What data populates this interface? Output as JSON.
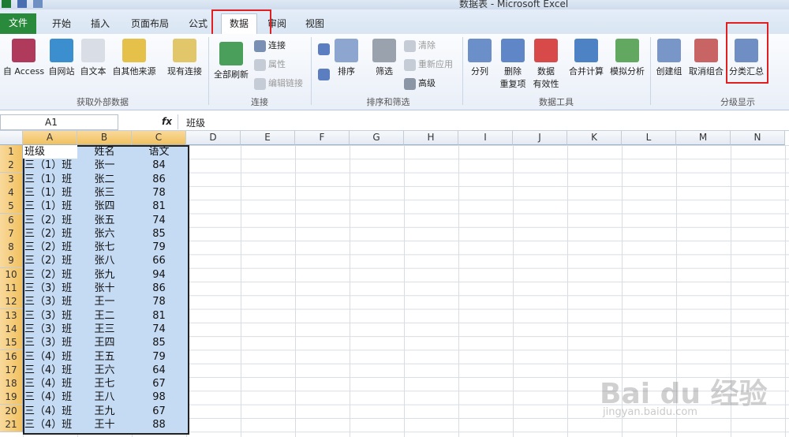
{
  "window": {
    "title": "数据表 - Microsoft Excel"
  },
  "tabs": [
    "文件",
    "开始",
    "插入",
    "页面布局",
    "公式",
    "数据",
    "审阅",
    "视图"
  ],
  "ribbon": {
    "external": {
      "access": "自 Access",
      "web": "自网站",
      "text": "自文本",
      "other": "自其他来源",
      "existing": "现有连接",
      "group": "获取外部数据"
    },
    "connections": {
      "refresh": "全部刷新",
      "conn": "连接",
      "props": "属性",
      "edit": "编辑链接",
      "group": "连接"
    },
    "sortfilter": {
      "sort": "排序",
      "filter": "筛选",
      "clear": "清除",
      "reapply": "重新应用",
      "advanced": "高级",
      "group": "排序和筛选"
    },
    "tools": {
      "split": "分列",
      "dedup1": "删除",
      "dedup2": "重复项",
      "valid1": "数据",
      "valid2": "有效性",
      "consolidate": "合并计算",
      "whatif": "模拟分析",
      "group": "数据工具"
    },
    "outline": {
      "groupbtn": "创建组",
      "ungroup": "取消组合",
      "subtotal": "分类汇总",
      "group": "分级显示"
    }
  },
  "formula": {
    "cell": "A1",
    "fx": "fx",
    "value": "班级"
  },
  "columns": [
    "A",
    "B",
    "C",
    "D",
    "E",
    "F",
    "G",
    "H",
    "I",
    "J",
    "K",
    "L",
    "M",
    "N"
  ],
  "rows": [
    [
      "班级",
      "姓名",
      "语文"
    ],
    [
      "三（1）班",
      "张一",
      "84"
    ],
    [
      "三（1）班",
      "张二",
      "86"
    ],
    [
      "三（1）班",
      "张三",
      "78"
    ],
    [
      "三（1）班",
      "张四",
      "81"
    ],
    [
      "三（2）班",
      "张五",
      "74"
    ],
    [
      "三（2）班",
      "张六",
      "85"
    ],
    [
      "三（2）班",
      "张七",
      "79"
    ],
    [
      "三（2）班",
      "张八",
      "66"
    ],
    [
      "三（2）班",
      "张九",
      "94"
    ],
    [
      "三（3）班",
      "张十",
      "86"
    ],
    [
      "三（3）班",
      "王一",
      "78"
    ],
    [
      "三（3）班",
      "王二",
      "81"
    ],
    [
      "三（3）班",
      "王三",
      "74"
    ],
    [
      "三（3）班",
      "王四",
      "85"
    ],
    [
      "三（4）班",
      "王五",
      "79"
    ],
    [
      "三（4）班",
      "王六",
      "64"
    ],
    [
      "三（4）班",
      "王七",
      "67"
    ],
    [
      "三（4）班",
      "王八",
      "98"
    ],
    [
      "三（4）班",
      "王九",
      "67"
    ],
    [
      "三（4）班",
      "王十",
      "88"
    ]
  ],
  "watermark": {
    "main": "Bai du 经验",
    "sub": "jingyan.baidu.com"
  }
}
